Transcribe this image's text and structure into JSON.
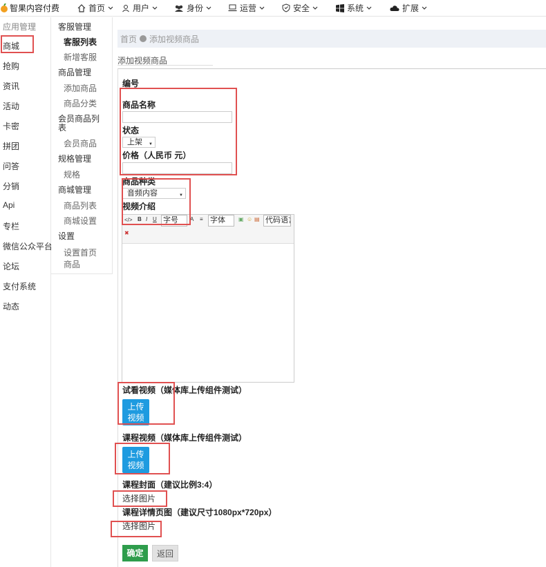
{
  "brand": {
    "name": "智果内容付费"
  },
  "nav": [
    {
      "label": "首页",
      "icon": "home-icon"
    },
    {
      "label": "用户",
      "icon": "user-icon"
    },
    {
      "label": "身份",
      "icon": "group-icon"
    },
    {
      "label": "运营",
      "icon": "monitor-icon"
    },
    {
      "label": "安全",
      "icon": "shield-icon"
    },
    {
      "label": "系统",
      "icon": "windows-icon"
    },
    {
      "label": "扩展",
      "icon": "cloud-icon"
    }
  ],
  "sidebar": {
    "title": "应用管理",
    "items": [
      "商城",
      "抢购",
      "资讯",
      "活动",
      "卡密",
      "拼团",
      "问答",
      "分销",
      "Api",
      "专栏",
      "微信公众平台",
      "论坛",
      "支付系统",
      "动态"
    ]
  },
  "submenu": {
    "g1": "客服管理",
    "g1_items": [
      "客服列表",
      "新增客服"
    ],
    "g2": "商品管理",
    "g2_items": [
      "添加商品",
      "商品分类"
    ],
    "g3": "会员商品列表",
    "g3_items": [
      "会员商品"
    ],
    "g4": "规格管理",
    "g4_items": [
      "规格"
    ],
    "g5": "商城管理",
    "g5_items": [
      "商品列表",
      "商城设置"
    ],
    "g6": "设置",
    "g6_items": [
      "设置首页商品"
    ]
  },
  "breadcrumb": {
    "home": "首页",
    "current": "添加视频商品"
  },
  "tab": {
    "label": "添加视频商品"
  },
  "form": {
    "id_label": "编号",
    "name_label": "商品名称",
    "status_label": "状态",
    "status_value": "上架",
    "price_label": "价格（人民币 元）",
    "category_label": "商品种类",
    "category_value": "音频内容",
    "intro_label": "视频介绍",
    "editor": {
      "font_size": "字号",
      "font_family": "字体",
      "code": "代码语言"
    },
    "trial_label": "试看视频（媒体库上传组件测试）",
    "upload_label_1": "上传",
    "upload_label_2": "视频",
    "course_label": "课程视频（媒体库上传组件测试）",
    "cover_label": "课程封面（建议比例3:4）",
    "select_image": "选择图片",
    "detail_label": "课程详情页图（建议尺寸1080px*720px）",
    "ok": "确定",
    "back": "返回"
  }
}
